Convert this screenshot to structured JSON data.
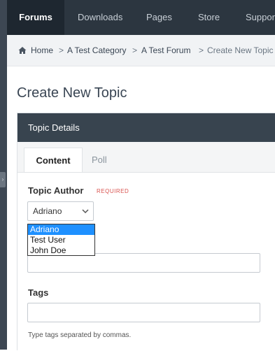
{
  "nav": {
    "items": [
      "Forums",
      "Downloads",
      "Pages",
      "Store",
      "Support"
    ]
  },
  "breadcrumb": {
    "home": "Home",
    "category": "A Test Category",
    "forum": "A Test Forum",
    "current": "Create New Topic",
    "separator": ">"
  },
  "page": {
    "title": "Create New Topic"
  },
  "panel": {
    "title": "Topic Details",
    "tabs": [
      "Content",
      "Poll"
    ]
  },
  "form": {
    "author_label": "Topic Author",
    "required_label": "REQUIRED",
    "author_value": "Adriano",
    "author_options": [
      "Adriano",
      "Test User",
      "John Doe"
    ],
    "tags_label": "Tags",
    "tags_help": "Type tags separated by commas."
  },
  "colors": {
    "nav_bg": "#2c3640",
    "panel_header_bg": "#38444f",
    "required": "#d9534f",
    "dropdown_selected": "#1e90ff"
  }
}
